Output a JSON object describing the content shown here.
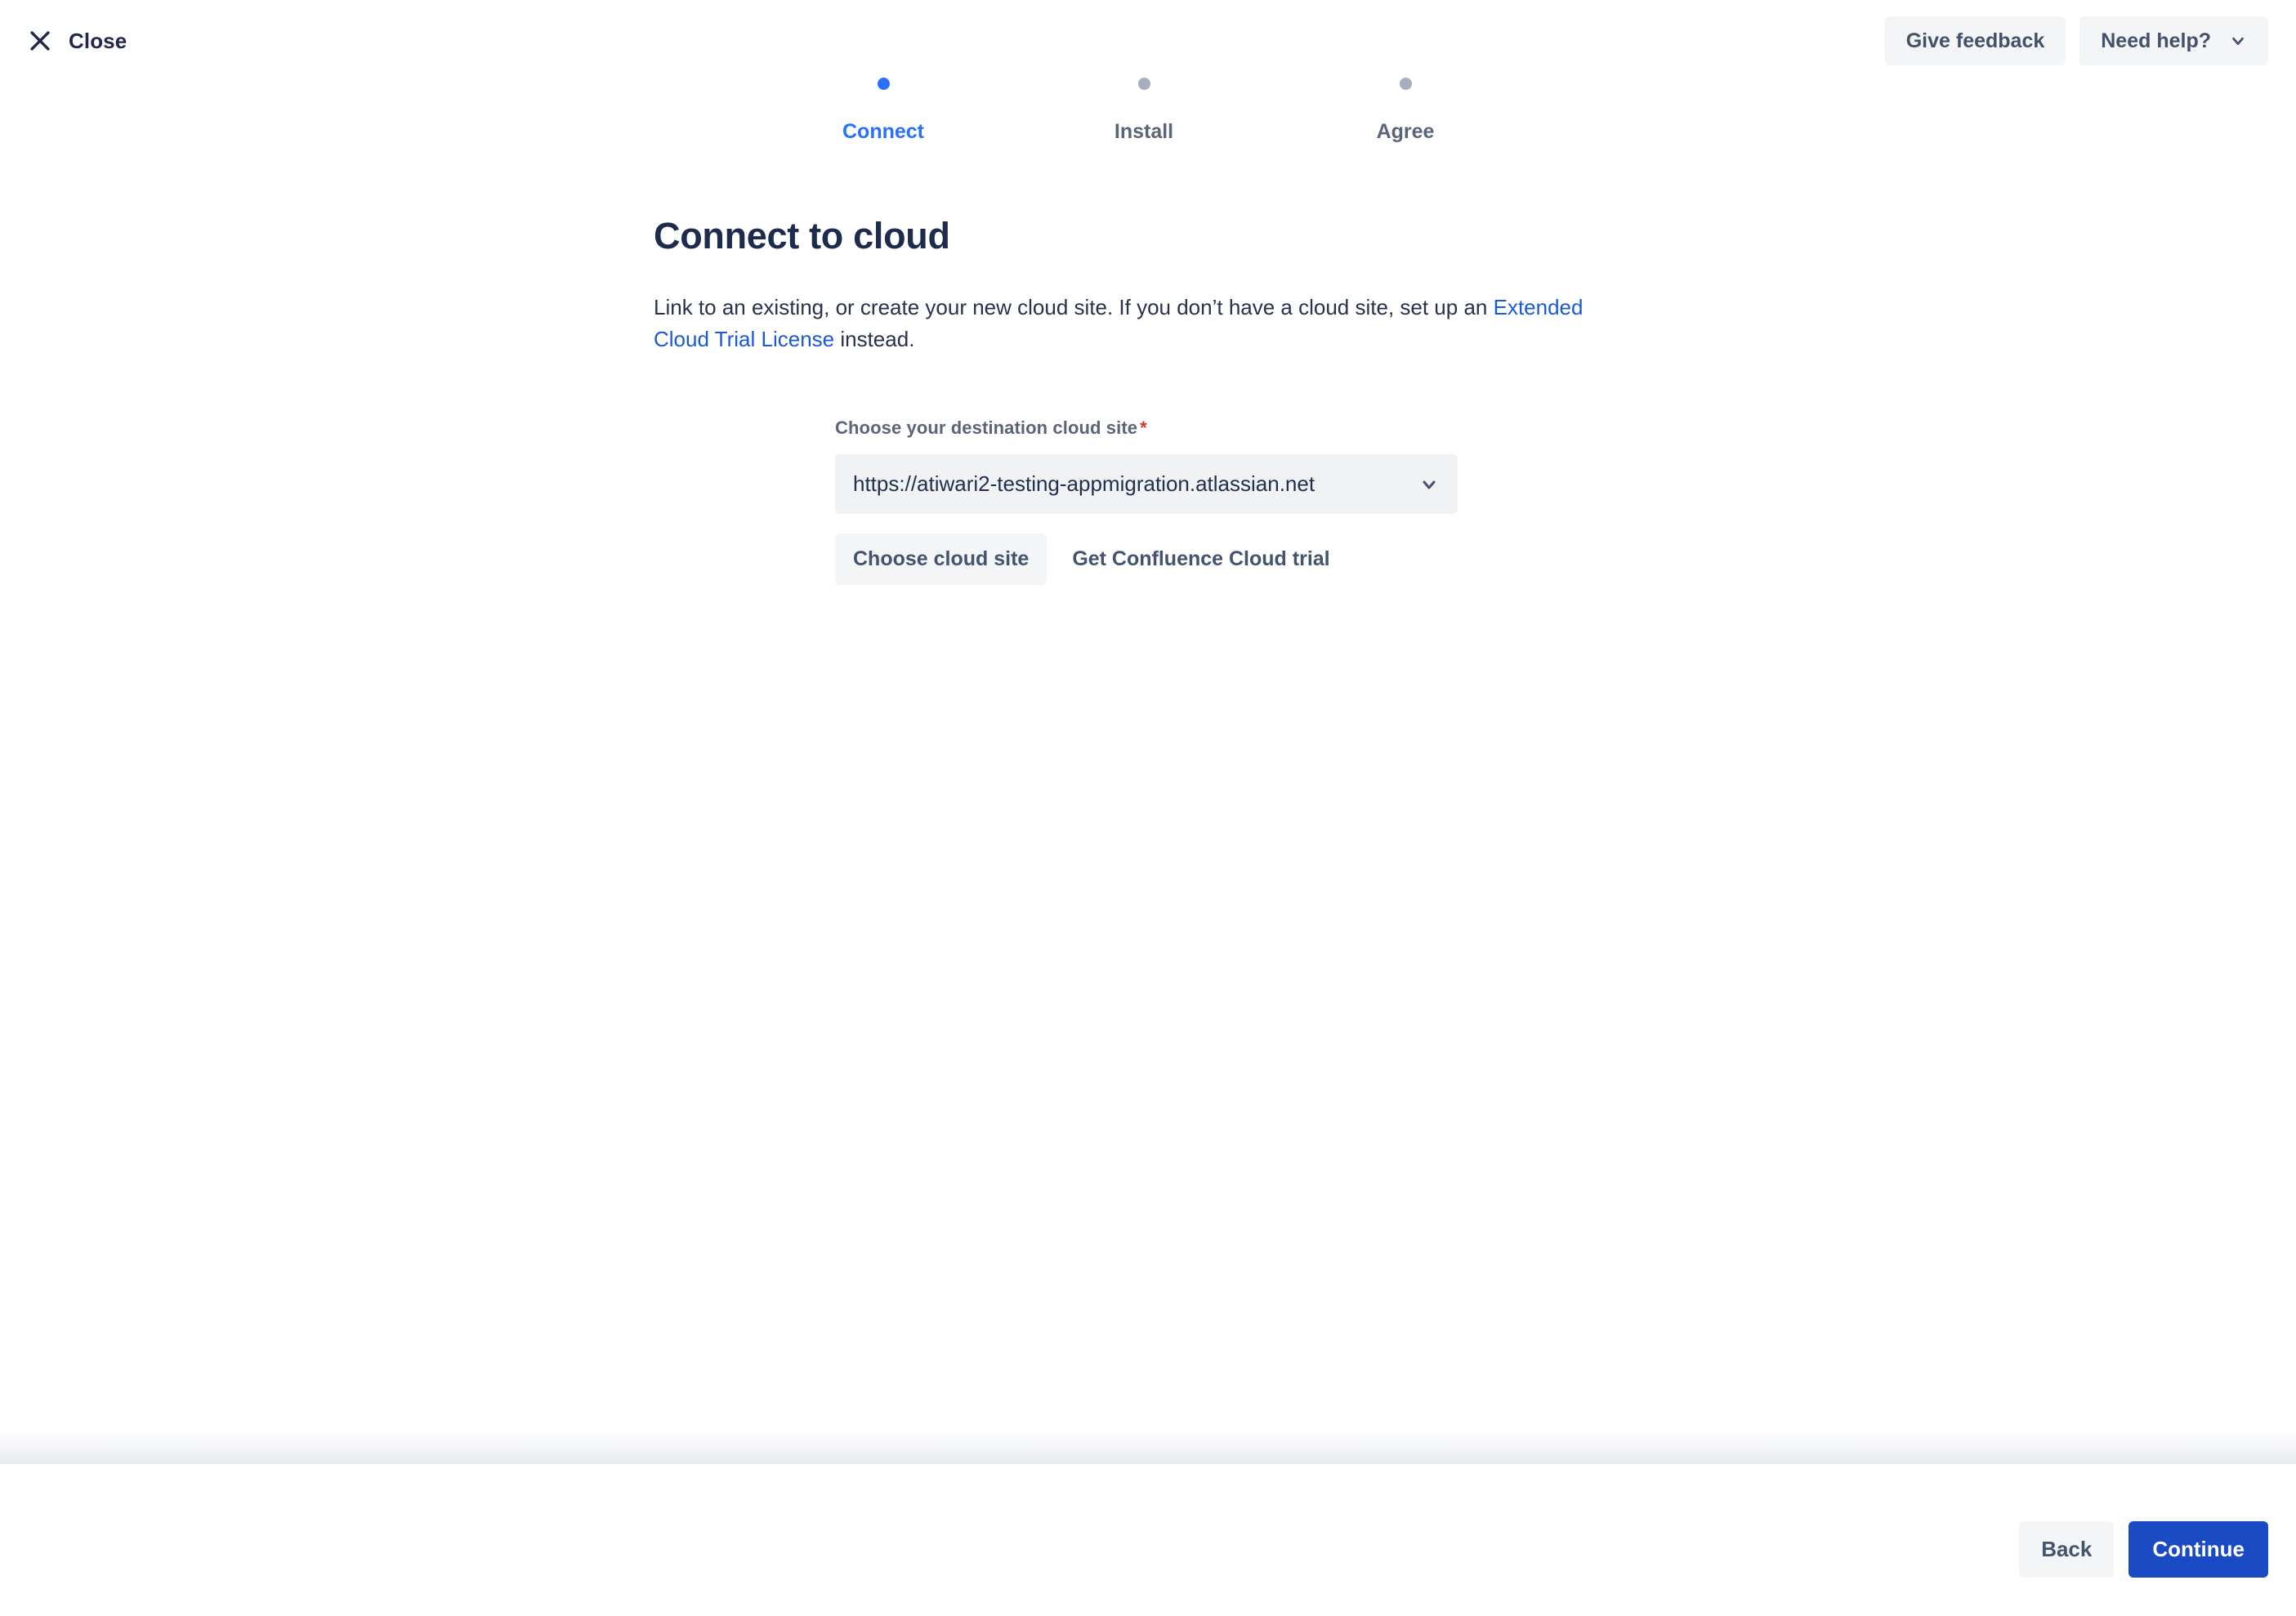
{
  "topbar": {
    "close_label": "Close",
    "close_icon": "close-icon",
    "feedback_label": "Give feedback",
    "help_label": "Need help?",
    "help_icon": "chevron-down-icon"
  },
  "stepper": {
    "steps": [
      {
        "label": "Connect",
        "state": "active"
      },
      {
        "label": "Install",
        "state": "inactive"
      },
      {
        "label": "Agree",
        "state": "inactive"
      }
    ],
    "active_color": "#2970FF",
    "inactive_color": "#A6ADBB"
  },
  "main": {
    "title": "Connect to cloud",
    "desc_before": "Link to an existing, or create your new cloud site. If you don’t have a cloud site, set up an ",
    "desc_link": "Extended Cloud Trial License",
    "desc_after": " instead."
  },
  "form": {
    "label": "Choose your destination cloud site",
    "required_marker": "*",
    "required_color": "#C9372C",
    "select_value": "https://atiwari2-testing-appmigration.atlassian.net",
    "select_icon": "chevron-down-icon",
    "choose_site_label": "Choose cloud site",
    "trial_label": "Get Confluence Cloud trial"
  },
  "footer": {
    "back_label": "Back",
    "continue_label": "Continue",
    "primary_color": "#1B4BC4"
  }
}
